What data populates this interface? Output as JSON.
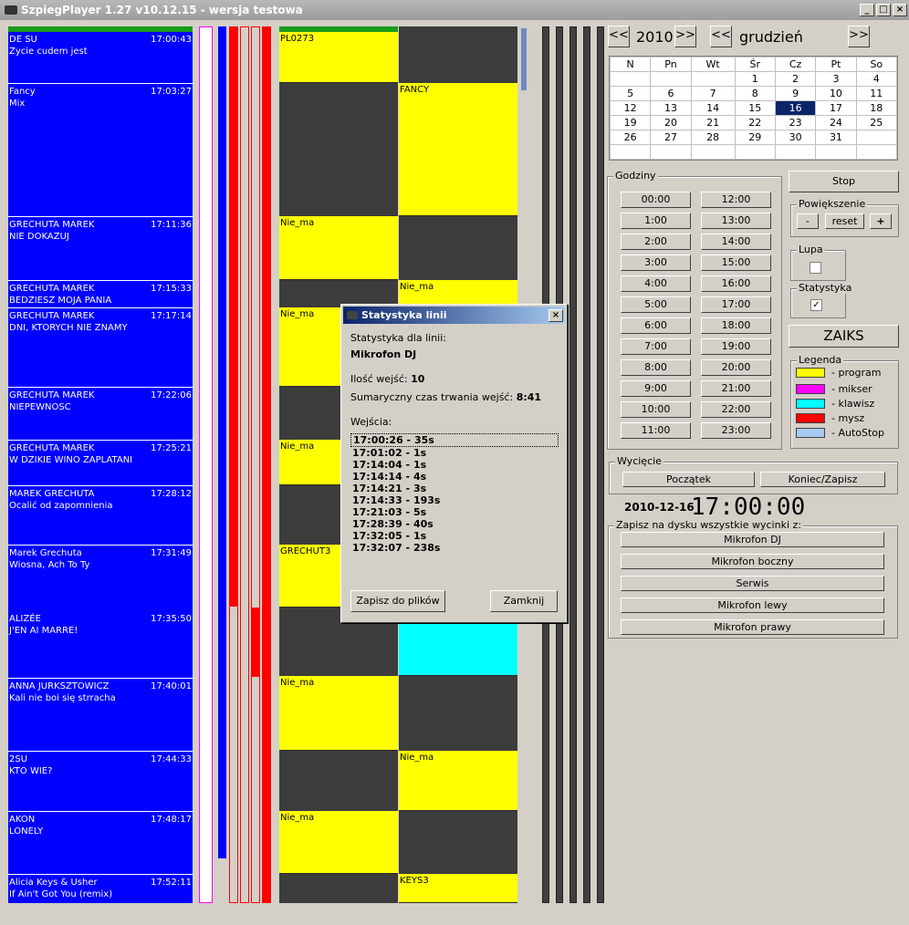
{
  "window": {
    "title": "SzpiegPlayer 1.27 v10.12.15 - wersja testowa",
    "min": "_",
    "max": "□",
    "close": "×"
  },
  "tracks": [
    {
      "artist": "DE SU",
      "song": "Zycie cudem jest",
      "time": "17:00:43"
    },
    {
      "artist": "Fancy",
      "song": "Mix",
      "time": "17:03:27"
    },
    {
      "artist": "GRECHUTA MAREK",
      "song": "NIE DOKAZUJ",
      "time": "17:11:36"
    },
    {
      "artist": "GRECHUTA MAREK",
      "song": "BEDZIESZ MOJA PANIA",
      "time": "17:15:33"
    },
    {
      "artist": "GRECHUTA MAREK",
      "song": "DNI, KTORYCH NIE ZNAMY",
      "time": "17:17:14"
    },
    {
      "artist": "GRECHUTA MAREK",
      "song": "NIEPEWNOSC",
      "time": "17:22:06"
    },
    {
      "artist": "GRECHUTA MAREK",
      "song": "W DZIKIE WINO ZAPLATANI",
      "time": "17:25:21"
    },
    {
      "artist": "MAREK GRECHUTA",
      "song": "Ocalić od zapomnienia",
      "time": "17:28:12"
    },
    {
      "artist": "Marek Grechuta",
      "song": "Wiosna, Ach To Ty",
      "time": "17:31:49"
    },
    {
      "artist": "ALIZÉE",
      "song": "J'EN AI MARRE!",
      "time": "17:35:50"
    },
    {
      "artist": "ANNA JURKSZTOWICZ",
      "song": "Kali nie boi się strracha",
      "time": "17:40:01"
    },
    {
      "artist": "2SU",
      "song": "KTO WIE?",
      "time": "17:44:33"
    },
    {
      "artist": "AKON",
      "song": "LONELY",
      "time": "17:48:17"
    },
    {
      "artist": "Alicia Keys & Usher",
      "song": "If Ain't Got You (remix)",
      "time": "17:52:11"
    }
  ],
  "col1_labels": [
    "PL0273",
    "Nie_ma",
    "Nie_ma",
    "Nie_ma",
    "GRECHUT3",
    "Nie_ma",
    "Nie_ma"
  ],
  "col2_labels": [
    "FANCY",
    "Nie_ma",
    "Nie_ma",
    "KEYS3"
  ],
  "calendar": {
    "year": "2010",
    "month": "grudzień",
    "prev": "<<",
    "next": ">>",
    "days": [
      "N",
      "Pn",
      "Wt",
      "Śr",
      "Cz",
      "Pt",
      "So"
    ],
    "weeks": [
      [
        "",
        "",
        "",
        "1",
        "2",
        "3",
        "4"
      ],
      [
        "5",
        "6",
        "7",
        "8",
        "9",
        "10",
        "11"
      ],
      [
        "12",
        "13",
        "14",
        "15",
        "16",
        "17",
        "18"
      ],
      [
        "19",
        "20",
        "21",
        "22",
        "23",
        "24",
        "25"
      ],
      [
        "26",
        "27",
        "28",
        "29",
        "30",
        "31",
        ""
      ],
      [
        "",
        "",
        "",
        "",
        "",
        "",
        ""
      ]
    ],
    "selected": "16"
  },
  "hours": {
    "label": "Godziny",
    "left": [
      "00:00",
      "1:00",
      "2:00",
      "3:00",
      "4:00",
      "5:00",
      "6:00",
      "7:00",
      "8:00",
      "9:00",
      "10:00",
      "11:00"
    ],
    "right": [
      "12:00",
      "13:00",
      "14:00",
      "15:00",
      "16:00",
      "17:00",
      "18:00",
      "19:00",
      "20:00",
      "21:00",
      "22:00",
      "23:00"
    ]
  },
  "controls": {
    "stop": "Stop",
    "zoom_label": "Powiększenie",
    "zoom_minus": "-",
    "zoom_reset": "reset",
    "zoom_plus": "+",
    "lupa_label": "Lupa",
    "stat_label": "Statystyka",
    "stat_check": "✓",
    "zaiks": "ZAIKS"
  },
  "legend": {
    "label": "Legenda",
    "items": [
      {
        "text": "- program",
        "color": "#ffff00"
      },
      {
        "text": "- mikser",
        "color": "#ff00ff"
      },
      {
        "text": "- klawisz",
        "color": "#00ffff"
      },
      {
        "text": "- mysz",
        "color": "#ff0000"
      },
      {
        "text": "- AutoStop",
        "color": "#a6caf0"
      }
    ]
  },
  "cut": {
    "label": "Wycięcie",
    "start": "Początek",
    "end": "Koniec/Zapisz"
  },
  "datetime": {
    "date": "2010-12-16",
    "time": "17:00:00"
  },
  "save": {
    "label": "Zapisz na dysku wszystkie wycinki z:",
    "buttons": [
      "Mikrofon DJ",
      "Mikrofon boczny",
      "Serwis",
      "Mikrofon lewy",
      "Mikrofon prawy"
    ]
  },
  "dialog": {
    "title": "Statystyka linii",
    "for_line_label": "Statystyka dla linii:",
    "line_name": "Mikrofon DJ",
    "count_label": "Ilość wejść:",
    "count_value": "10",
    "total_label": "Sumaryczny czas trwania wejść:",
    "total_value": "8:41",
    "entries_label": "Wejścia:",
    "entries": [
      "17:00:26 - 35s",
      "17:01:02 - 1s",
      "17:14:04 - 1s",
      "17:14:14 - 4s",
      "17:14:21 - 3s",
      "17:14:33 - 193s",
      "17:21:03 - 5s",
      "17:28:39 - 40s",
      "17:32:05 - 1s",
      "17:32:07 - 238s"
    ],
    "save_button": "Zapisz do plików",
    "close_button": "Zamknij",
    "close_x": "×"
  }
}
